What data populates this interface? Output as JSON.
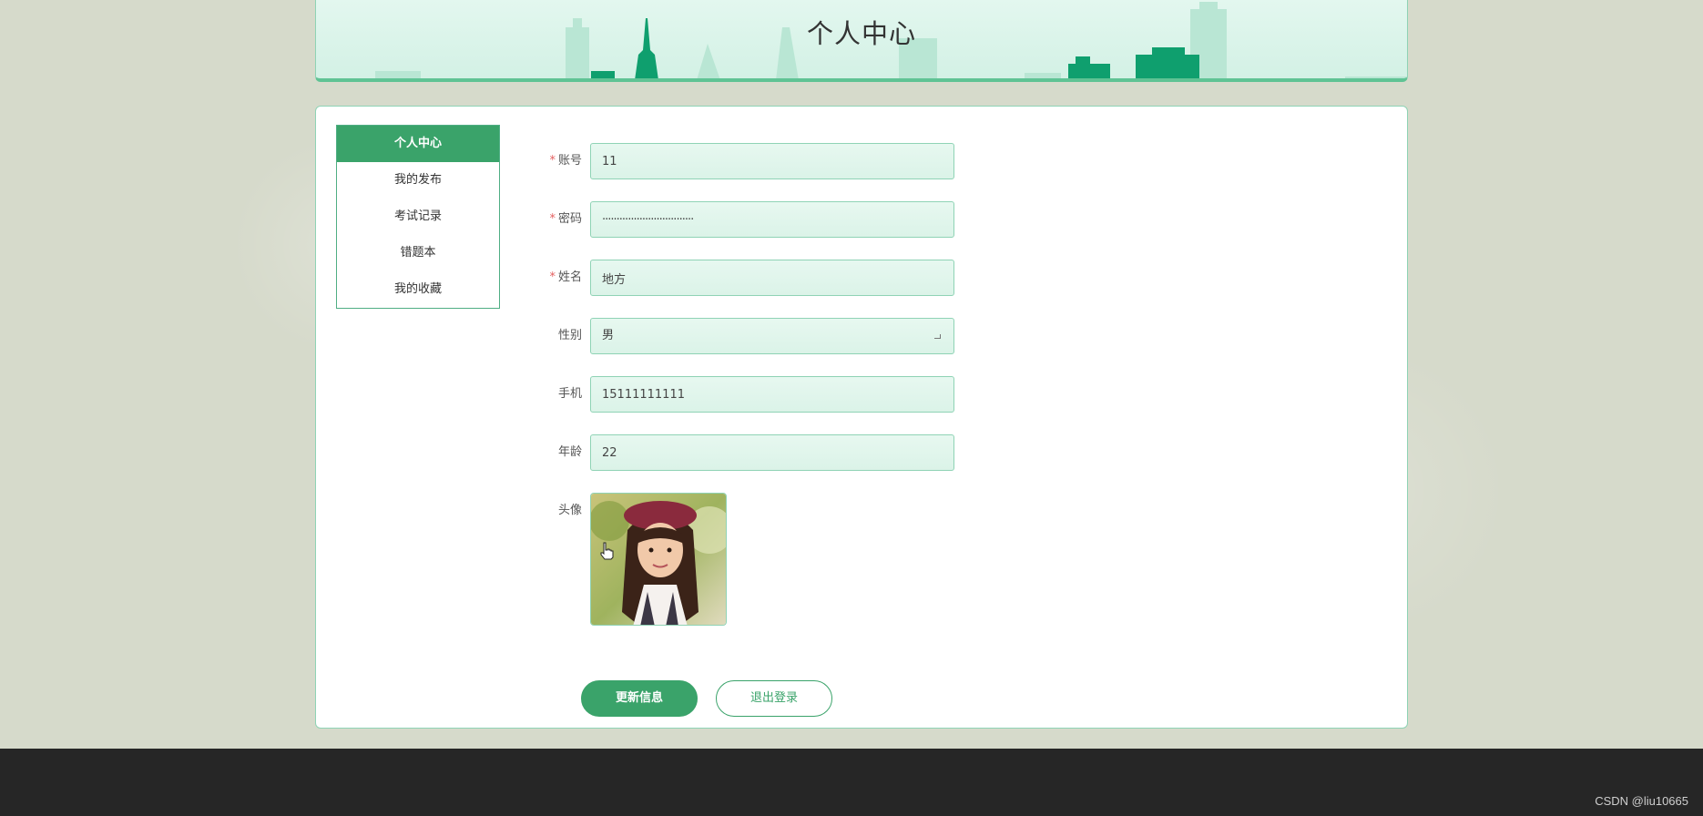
{
  "header": {
    "title": "个人中心"
  },
  "sidebar": {
    "items": [
      {
        "label": "个人中心",
        "active": true
      },
      {
        "label": "我的发布"
      },
      {
        "label": "考试记录"
      },
      {
        "label": "错题本"
      },
      {
        "label": "我的收藏"
      }
    ]
  },
  "form": {
    "account": {
      "label": "账号",
      "required": "*",
      "value": "11"
    },
    "password": {
      "label": "密码",
      "required": "*",
      "value": "································"
    },
    "name": {
      "label": "姓名",
      "required": "*",
      "value": "地方"
    },
    "gender": {
      "label": "性别",
      "value": "男"
    },
    "phone": {
      "label": "手机",
      "value": "15111111111"
    },
    "age": {
      "label": "年龄",
      "value": "22"
    },
    "avatar": {
      "label": "头像"
    }
  },
  "buttons": {
    "update": "更新信息",
    "logout": "退出登录"
  },
  "watermark": "CSDN @liu10665",
  "colors": {
    "primary": "#3aa36a",
    "border": "#8fd3b5",
    "footer": "#262626"
  }
}
